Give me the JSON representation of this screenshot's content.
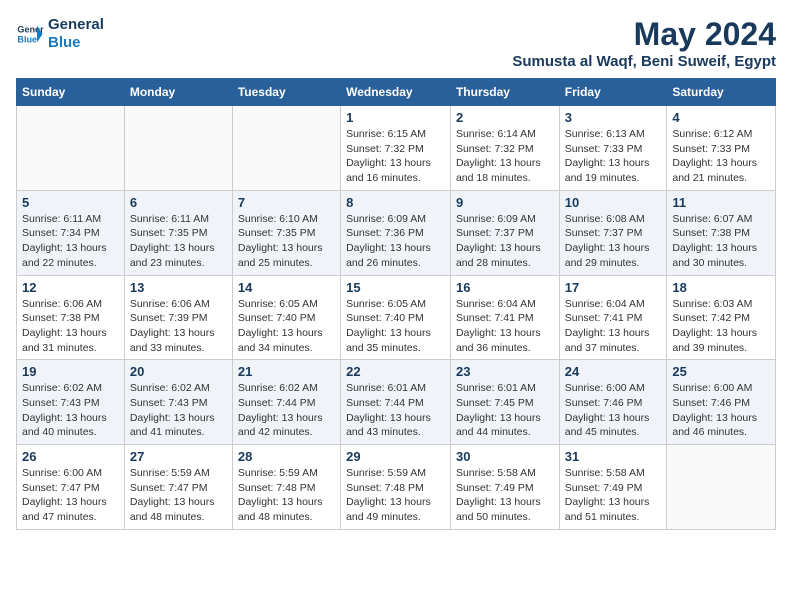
{
  "header": {
    "logo_line1": "General",
    "logo_line2": "Blue",
    "title": "May 2024",
    "subtitle": "Sumusta al Waqf, Beni Suweif, Egypt"
  },
  "columns": [
    "Sunday",
    "Monday",
    "Tuesday",
    "Wednesday",
    "Thursday",
    "Friday",
    "Saturday"
  ],
  "weeks": [
    [
      {
        "day": "",
        "info": ""
      },
      {
        "day": "",
        "info": ""
      },
      {
        "day": "",
        "info": ""
      },
      {
        "day": "1",
        "info": "Sunrise: 6:15 AM\nSunset: 7:32 PM\nDaylight: 13 hours and 16 minutes."
      },
      {
        "day": "2",
        "info": "Sunrise: 6:14 AM\nSunset: 7:32 PM\nDaylight: 13 hours and 18 minutes."
      },
      {
        "day": "3",
        "info": "Sunrise: 6:13 AM\nSunset: 7:33 PM\nDaylight: 13 hours and 19 minutes."
      },
      {
        "day": "4",
        "info": "Sunrise: 6:12 AM\nSunset: 7:33 PM\nDaylight: 13 hours and 21 minutes."
      }
    ],
    [
      {
        "day": "5",
        "info": "Sunrise: 6:11 AM\nSunset: 7:34 PM\nDaylight: 13 hours and 22 minutes."
      },
      {
        "day": "6",
        "info": "Sunrise: 6:11 AM\nSunset: 7:35 PM\nDaylight: 13 hours and 23 minutes."
      },
      {
        "day": "7",
        "info": "Sunrise: 6:10 AM\nSunset: 7:35 PM\nDaylight: 13 hours and 25 minutes."
      },
      {
        "day": "8",
        "info": "Sunrise: 6:09 AM\nSunset: 7:36 PM\nDaylight: 13 hours and 26 minutes."
      },
      {
        "day": "9",
        "info": "Sunrise: 6:09 AM\nSunset: 7:37 PM\nDaylight: 13 hours and 28 minutes."
      },
      {
        "day": "10",
        "info": "Sunrise: 6:08 AM\nSunset: 7:37 PM\nDaylight: 13 hours and 29 minutes."
      },
      {
        "day": "11",
        "info": "Sunrise: 6:07 AM\nSunset: 7:38 PM\nDaylight: 13 hours and 30 minutes."
      }
    ],
    [
      {
        "day": "12",
        "info": "Sunrise: 6:06 AM\nSunset: 7:38 PM\nDaylight: 13 hours and 31 minutes."
      },
      {
        "day": "13",
        "info": "Sunrise: 6:06 AM\nSunset: 7:39 PM\nDaylight: 13 hours and 33 minutes."
      },
      {
        "day": "14",
        "info": "Sunrise: 6:05 AM\nSunset: 7:40 PM\nDaylight: 13 hours and 34 minutes."
      },
      {
        "day": "15",
        "info": "Sunrise: 6:05 AM\nSunset: 7:40 PM\nDaylight: 13 hours and 35 minutes."
      },
      {
        "day": "16",
        "info": "Sunrise: 6:04 AM\nSunset: 7:41 PM\nDaylight: 13 hours and 36 minutes."
      },
      {
        "day": "17",
        "info": "Sunrise: 6:04 AM\nSunset: 7:41 PM\nDaylight: 13 hours and 37 minutes."
      },
      {
        "day": "18",
        "info": "Sunrise: 6:03 AM\nSunset: 7:42 PM\nDaylight: 13 hours and 39 minutes."
      }
    ],
    [
      {
        "day": "19",
        "info": "Sunrise: 6:02 AM\nSunset: 7:43 PM\nDaylight: 13 hours and 40 minutes."
      },
      {
        "day": "20",
        "info": "Sunrise: 6:02 AM\nSunset: 7:43 PM\nDaylight: 13 hours and 41 minutes."
      },
      {
        "day": "21",
        "info": "Sunrise: 6:02 AM\nSunset: 7:44 PM\nDaylight: 13 hours and 42 minutes."
      },
      {
        "day": "22",
        "info": "Sunrise: 6:01 AM\nSunset: 7:44 PM\nDaylight: 13 hours and 43 minutes."
      },
      {
        "day": "23",
        "info": "Sunrise: 6:01 AM\nSunset: 7:45 PM\nDaylight: 13 hours and 44 minutes."
      },
      {
        "day": "24",
        "info": "Sunrise: 6:00 AM\nSunset: 7:46 PM\nDaylight: 13 hours and 45 minutes."
      },
      {
        "day": "25",
        "info": "Sunrise: 6:00 AM\nSunset: 7:46 PM\nDaylight: 13 hours and 46 minutes."
      }
    ],
    [
      {
        "day": "26",
        "info": "Sunrise: 6:00 AM\nSunset: 7:47 PM\nDaylight: 13 hours and 47 minutes."
      },
      {
        "day": "27",
        "info": "Sunrise: 5:59 AM\nSunset: 7:47 PM\nDaylight: 13 hours and 48 minutes."
      },
      {
        "day": "28",
        "info": "Sunrise: 5:59 AM\nSunset: 7:48 PM\nDaylight: 13 hours and 48 minutes."
      },
      {
        "day": "29",
        "info": "Sunrise: 5:59 AM\nSunset: 7:48 PM\nDaylight: 13 hours and 49 minutes."
      },
      {
        "day": "30",
        "info": "Sunrise: 5:58 AM\nSunset: 7:49 PM\nDaylight: 13 hours and 50 minutes."
      },
      {
        "day": "31",
        "info": "Sunrise: 5:58 AM\nSunset: 7:49 PM\nDaylight: 13 hours and 51 minutes."
      },
      {
        "day": "",
        "info": ""
      }
    ]
  ]
}
